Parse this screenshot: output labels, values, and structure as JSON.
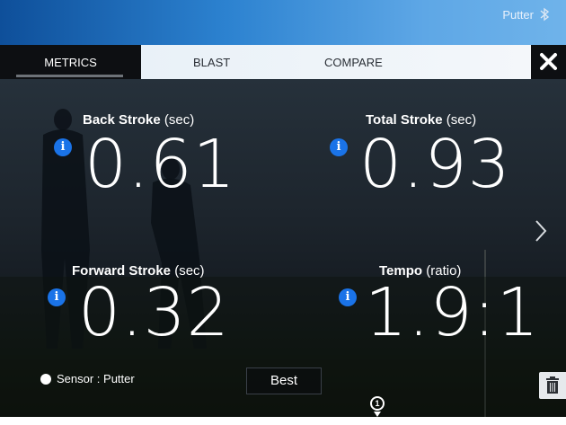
{
  "header": {
    "device": "Putter"
  },
  "tabs": [
    {
      "label": "METRICS",
      "active": true
    },
    {
      "label": "BLAST",
      "active": false
    },
    {
      "label": "COMPARE",
      "active": false
    }
  ],
  "metrics": {
    "back_stroke": {
      "label": "Back Stroke",
      "unit": "(sec)",
      "value": "0.61"
    },
    "total_stroke": {
      "label": "Total Stroke",
      "unit": "(sec)",
      "value": "0.93"
    },
    "forward_stroke": {
      "label": "Forward Stroke",
      "unit": "(sec)",
      "value": "0.32"
    },
    "tempo": {
      "label": "Tempo",
      "unit": "(ratio)",
      "value": "1.9:1"
    }
  },
  "footer": {
    "sensor": "Sensor : Putter",
    "best_label": "Best",
    "marker": "1"
  },
  "colors": {
    "accent": "#1a73e8",
    "header_blue": "#2c82d0"
  },
  "icons": [
    "bluetooth-icon",
    "close-icon",
    "info-icon",
    "chevron-right-icon",
    "trash-icon"
  ]
}
